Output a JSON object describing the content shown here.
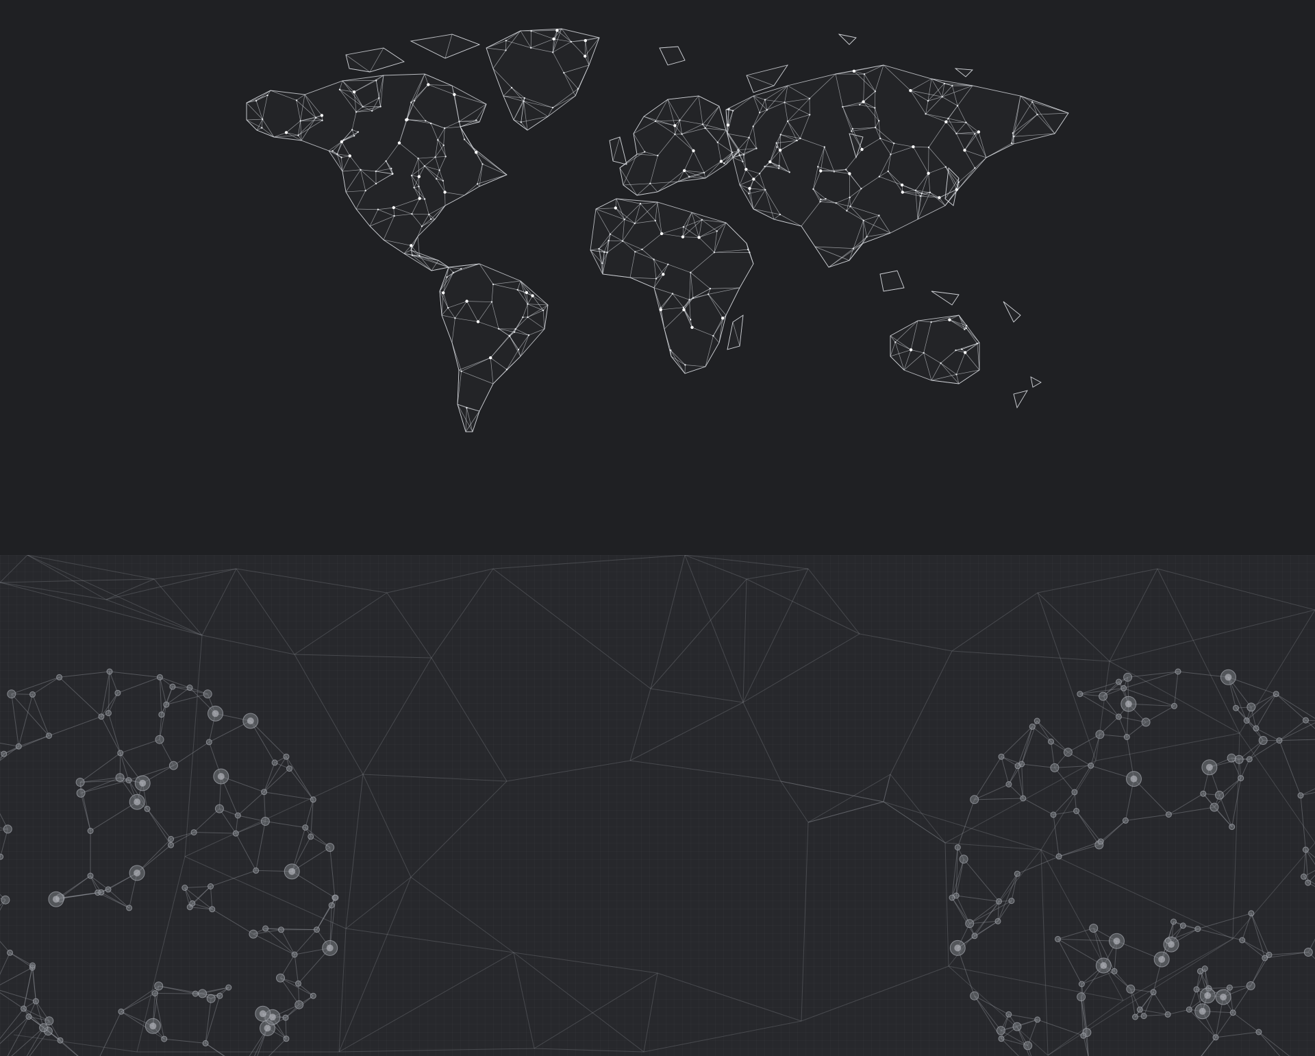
{
  "scene": {
    "top_panel": {
      "description_id": "world-network-map",
      "colors": {
        "background": "#1f2023",
        "lines": "#e1e4e8",
        "nodes": "#ffffff"
      }
    },
    "bottom_panel": {
      "description_id": "abstract-network-background",
      "colors": {
        "background": "#27282c",
        "lines": "#8c8f96",
        "nodes": "#787b82"
      }
    }
  }
}
